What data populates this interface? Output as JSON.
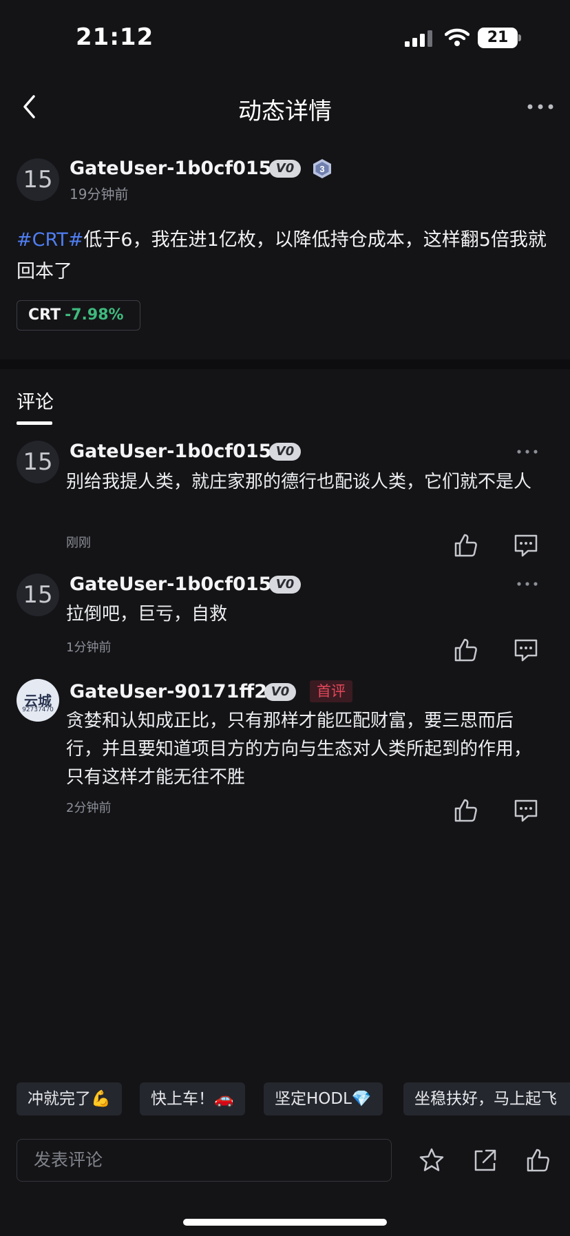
{
  "status_bar": {
    "time": "21:12",
    "battery": "21"
  },
  "nav": {
    "title": "动态详情"
  },
  "post": {
    "avatar_text": "15",
    "author": "GateUser-1b0cf015",
    "vip_badge": "V0",
    "level_badge": "3",
    "time_ago": "19分钟前",
    "hashtag": "#CRT#",
    "body": "低于6，我在进1亿枚，以降低持仓成本，这样翻5倍我就回本了",
    "coin": {
      "symbol": "CRT",
      "change": "-7.98%"
    }
  },
  "tabs": {
    "comments_label": "评论"
  },
  "comments": [
    {
      "avatar_text": "15",
      "author": "GateUser-1b0cf015",
      "vip_badge": "V0",
      "text": "别给我提人类，就庄家那的德行也配谈人类，它们就不是人",
      "time_ago": "刚刚"
    },
    {
      "avatar_text": "15",
      "author": "GateUser-1b0cf015",
      "vip_badge": "V0",
      "text": "拉倒吧，巨亏，自救",
      "time_ago": "1分钟前"
    },
    {
      "avatar_text": "云城",
      "avatar_subtext": "92737470",
      "author": "GateUser-90171ff2",
      "vip_badge": "V0",
      "first_badge": "首评",
      "text": "贪婪和认知成正比，只有那样才能匹配财富，要三思而后行，并且要知道项目方的方向与生态对人类所起到的作用，只有这样才能无往不胜",
      "time_ago": "2分钟前"
    }
  ],
  "quick_replies": [
    "冲就完了💪",
    "快上车！🚗",
    "坚定HODL💎",
    "坐稳扶好，马上起飞"
  ],
  "comment_input": {
    "placeholder": "发表评论"
  },
  "colors": {
    "hashtag": "#4f7ef2",
    "price_change": "#3fba7e",
    "first_badge": "#e5485a",
    "background": "#141416"
  }
}
